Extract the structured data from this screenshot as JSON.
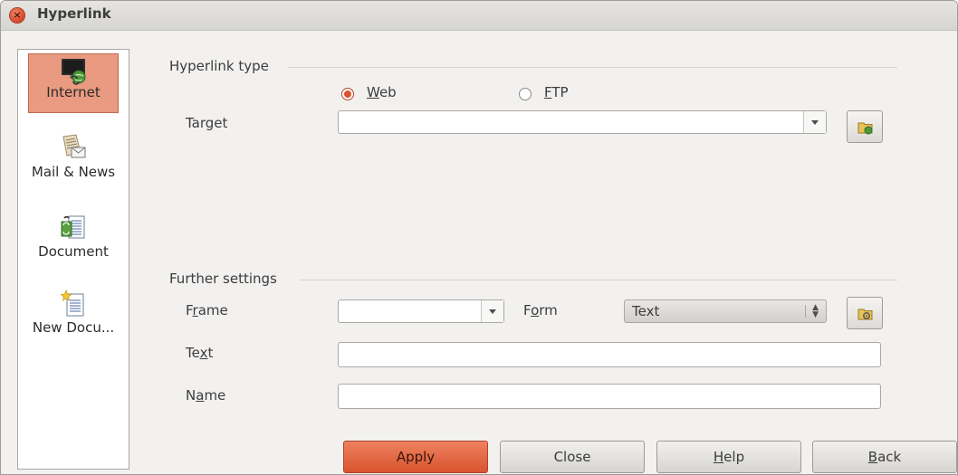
{
  "window": {
    "title": "Hyperlink"
  },
  "sidebar": {
    "items": [
      {
        "label": "Internet",
        "icon": "globe-computer-icon",
        "selected": true
      },
      {
        "label": "Mail & News",
        "icon": "mail-envelope-icon"
      },
      {
        "label": "Document",
        "icon": "document-link-icon"
      },
      {
        "label": "New Docu...",
        "icon": "new-document-icon"
      }
    ]
  },
  "hyperlink_type": {
    "title": "Hyperlink type",
    "web_mnemonic": "W",
    "web_rest": "eb",
    "ftp_mnemonic": "F",
    "ftp_rest": "TP",
    "selected": "Web",
    "target_label": "Target",
    "target_value": ""
  },
  "further": {
    "title": "Further settings",
    "frame_pre": "F",
    "frame_mnemonic": "r",
    "frame_post": "ame",
    "frame_value": "",
    "form_pre": "F",
    "form_mnemonic": "o",
    "form_post": "rm",
    "form_value": "Text",
    "text_pre": "Te",
    "text_mnemonic": "x",
    "text_post": "t",
    "text_value": "",
    "name_pre": "N",
    "name_mnemonic": "a",
    "name_post": "me",
    "name_value": ""
  },
  "buttons": {
    "apply": "Apply",
    "close": "Close",
    "help_mnemonic": "H",
    "help_rest": "elp",
    "back_mnemonic": "B",
    "back_rest": "ack"
  },
  "colors": {
    "accent": "#dd5030",
    "selected_bg": "#e99a80"
  }
}
